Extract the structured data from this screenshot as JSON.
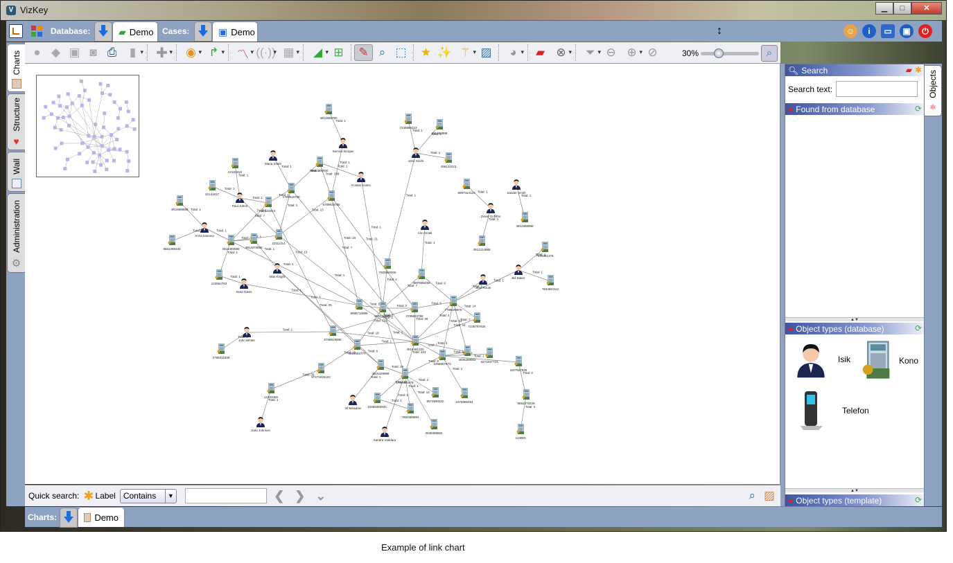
{
  "window": {
    "title": "VizKey",
    "controls": [
      "minimize",
      "maximize",
      "close"
    ]
  },
  "top_tabs": {
    "database_label": "Database:",
    "database_tab": "Demo",
    "cases_label": "Cases:",
    "cases_tab": "Demo"
  },
  "top_right_icons": [
    "user-icon",
    "info-icon",
    "fullscreen-icon",
    "lock-icon",
    "power-icon"
  ],
  "left_tabs": [
    {
      "label": "Charts",
      "icon": "chart-icon",
      "active": true
    },
    {
      "label": "Structure",
      "icon": "hearts-icon"
    },
    {
      "label": "Wall",
      "icon": "wall-icon"
    },
    {
      "label": "Administration",
      "icon": "gear-icon"
    }
  ],
  "toolbar": {
    "icons": [
      "disc-icon",
      "puzzle-icon",
      "window-icon",
      "window-disc-icon",
      "print-icon",
      "clipboard-icon",
      "add-icon",
      "eye-icon",
      "redirect-arrow-icon",
      "line-chart-icon",
      "antenna-icon",
      "map-icon",
      "triangle-icon",
      "fit-icon",
      "link-tool-icon",
      "search-window-icon",
      "select-area-icon",
      "star-icon",
      "stars-icon",
      "magic-wand-icon",
      "picture-icon",
      "palette-icon",
      "eraser-icon",
      "delete-icon",
      "filter-icon",
      "zoom-out-icon",
      "zoom-in-icon",
      "zoom-reset-icon"
    ],
    "zoom_label": "30%",
    "zoom_percent": 30
  },
  "right_panel": {
    "tab_label": "Objects",
    "search_header": "Search",
    "search_text_label": "Search text:",
    "search_value": "",
    "found_header": "Found from database",
    "object_types_db_header": "Object types (database)",
    "object_types": [
      {
        "label": "Isik",
        "icon": "person-icon"
      },
      {
        "label": "Kono",
        "icon": "account-icon"
      },
      {
        "label": "Telefon",
        "icon": "phone-icon"
      }
    ],
    "object_types_template_header": "Object types (template)"
  },
  "quick_search": {
    "label": "Quick search:",
    "field_label": "Label",
    "mode": "Contains",
    "value": ""
  },
  "charts_bar": {
    "label": "Charts:",
    "tab": "Demo"
  },
  "caption": "Example of link chart",
  "colors": {
    "frame": "#8ea3c1",
    "panel_header": "#3d55a0",
    "toolbar": "#eef0f5",
    "edge": "#888888"
  },
  "graph": {
    "nodes": [
      {
        "id": 1,
        "type": "account",
        "label": "4912688780"
      },
      {
        "id": 2,
        "type": "person",
        "label": "Semion Burgas"
      },
      {
        "id": 3,
        "type": "account",
        "label": "7239888123"
      },
      {
        "id": 4,
        "type": "account",
        "label": "231488888"
      },
      {
        "id": 5,
        "type": "person",
        "label": "John Smith"
      },
      {
        "id": 6,
        "type": "account",
        "label": "496122223"
      },
      {
        "id": 7,
        "type": "person",
        "label": "Maria Smith"
      },
      {
        "id": 8,
        "type": "account",
        "label": "9982300000"
      },
      {
        "id": 9,
        "type": "person",
        "label": "Kostas Evans"
      },
      {
        "id": 10,
        "type": "account",
        "label": "22181818"
      },
      {
        "id": 11,
        "type": "account",
        "label": "22141817"
      },
      {
        "id": 12,
        "type": "person",
        "label": "Paul Johns"
      },
      {
        "id": 13,
        "type": "account",
        "label": "22131813"
      },
      {
        "id": 14,
        "type": "account",
        "label": "1799918789"
      },
      {
        "id": 15,
        "type": "account",
        "label": "6789918789"
      },
      {
        "id": 16,
        "type": "account",
        "label": "4916888888"
      },
      {
        "id": 17,
        "type": "person",
        "label": "Anna Ivanova"
      },
      {
        "id": 18,
        "type": "account",
        "label": "8881288333"
      },
      {
        "id": 19,
        "type": "account",
        "label": "4916482999"
      },
      {
        "id": 20,
        "type": "account",
        "label": "4912878888"
      },
      {
        "id": 21,
        "type": "account",
        "label": "22111314"
      },
      {
        "id": 22,
        "type": "person",
        "label": "Max Knight"
      },
      {
        "id": 23,
        "type": "account",
        "label": "123964783"
      },
      {
        "id": 24,
        "type": "person",
        "label": "Sean Davis"
      },
      {
        "id": 25,
        "type": "person",
        "label": "Ann Small"
      },
      {
        "id": 26,
        "type": "account",
        "label": "8987444123"
      },
      {
        "id": 27,
        "type": "person",
        "label": "David Griffiths"
      },
      {
        "id": 28,
        "type": "person",
        "label": "Sander Smith"
      },
      {
        "id": 29,
        "type": "account",
        "label": "4912888999"
      },
      {
        "id": 30,
        "type": "account",
        "label": "4912214888"
      },
      {
        "id": 31,
        "type": "account",
        "label": "7844881378"
      },
      {
        "id": 32,
        "type": "person",
        "label": "Bill Baker"
      },
      {
        "id": 33,
        "type": "account",
        "label": "7844881112"
      },
      {
        "id": 34,
        "type": "person",
        "label": "Jean Roule"
      },
      {
        "id": 35,
        "type": "account",
        "label": "7000000000"
      },
      {
        "id": 36,
        "type": "account",
        "label": "4987896456"
      },
      {
        "id": 37,
        "type": "account",
        "label": "8998710999"
      },
      {
        "id": 38,
        "type": "account",
        "label": "4944422333"
      },
      {
        "id": 39,
        "type": "account",
        "label": "3789618786"
      },
      {
        "id": 40,
        "type": "account",
        "label": "7789189976"
      },
      {
        "id": 41,
        "type": "account",
        "label": "7236787934"
      },
      {
        "id": 42,
        "type": "person",
        "label": "John Whiter"
      },
      {
        "id": 43,
        "type": "account",
        "label": "2789311849"
      },
      {
        "id": 44,
        "type": "account",
        "label": "6789819888"
      },
      {
        "id": 45,
        "type": "account",
        "label": "4916483777"
      },
      {
        "id": 46,
        "type": "account",
        "label": "4916481222"
      },
      {
        "id": 47,
        "type": "account",
        "label": "2268887873"
      },
      {
        "id": 48,
        "type": "account",
        "label": "4938289993"
      },
      {
        "id": 49,
        "type": "account",
        "label": "8271837723"
      },
      {
        "id": 50,
        "type": "account",
        "label": "1187827828"
      },
      {
        "id": 51,
        "type": "account",
        "label": "97473432222"
      },
      {
        "id": 52,
        "type": "account",
        "label": "4916428999"
      },
      {
        "id": 53,
        "type": "account",
        "label": "1744881878"
      },
      {
        "id": 54,
        "type": "account",
        "label": "12123456"
      },
      {
        "id": 55,
        "type": "person",
        "label": "Jane Johnson"
      },
      {
        "id": 56,
        "type": "person",
        "label": "Jill Meadow"
      },
      {
        "id": 57,
        "type": "account",
        "label": "10489393934"
      },
      {
        "id": 58,
        "type": "account",
        "label": "7892389994"
      },
      {
        "id": 59,
        "type": "account",
        "label": "8574890222"
      },
      {
        "id": 60,
        "type": "account",
        "label": "2376889494"
      },
      {
        "id": 61,
        "type": "account",
        "label": "3038398882"
      },
      {
        "id": 62,
        "type": "person",
        "label": "Sandra Vaddara"
      },
      {
        "id": 63,
        "type": "account",
        "label": "8893478328"
      },
      {
        "id": 64,
        "type": "account",
        "label": "123983"
      }
    ],
    "edges": [
      [
        1,
        2,
        "Total: 1"
      ],
      [
        2,
        15,
        "Total: 1"
      ],
      [
        3,
        5,
        "Total: 1"
      ],
      [
        4,
        5,
        "Total: 1"
      ],
      [
        5,
        6,
        "Total: 1"
      ],
      [
        5,
        35,
        "Total: 1"
      ],
      [
        7,
        14,
        "Total: 1"
      ],
      [
        8,
        14,
        "Total: 7"
      ],
      [
        8,
        9,
        "Total: 1"
      ],
      [
        8,
        15,
        "Total: 299"
      ],
      [
        9,
        38,
        "Total: 1"
      ],
      [
        10,
        12,
        "Total: 1"
      ],
      [
        11,
        12,
        "Total: 1"
      ],
      [
        12,
        13,
        "Total: 1"
      ],
      [
        12,
        21,
        "Total: 1"
      ],
      [
        13,
        14,
        "Total: 4"
      ],
      [
        13,
        19,
        "Total: 7"
      ],
      [
        13,
        44,
        "Total: 13"
      ],
      [
        14,
        21,
        "Total: 1"
      ],
      [
        14,
        46,
        "Total: 7"
      ],
      [
        15,
        21,
        "Total: 13"
      ],
      [
        15,
        37,
        "Total: 18"
      ],
      [
        15,
        39,
        "Total: 21"
      ],
      [
        16,
        17,
        "Total: 1"
      ],
      [
        17,
        18,
        "Total: 1"
      ],
      [
        17,
        19,
        "Total: 1"
      ],
      [
        19,
        20,
        "Total: 3"
      ],
      [
        19,
        21,
        "Total: 1"
      ],
      [
        19,
        23,
        "Total: 4"
      ],
      [
        19,
        37,
        "Total: 1"
      ],
      [
        20,
        22,
        "Total: 1"
      ],
      [
        21,
        46,
        "Total: 1"
      ],
      [
        22,
        45,
        "Total: 3"
      ],
      [
        22,
        52,
        "Total: 29"
      ],
      [
        23,
        24,
        "Total: 1"
      ],
      [
        24,
        37,
        "Total: 1"
      ],
      [
        25,
        36,
        "Total: 1"
      ],
      [
        26,
        27,
        "Total: 1"
      ],
      [
        27,
        30,
        "Total: 1"
      ],
      [
        28,
        29,
        "Total: 1"
      ],
      [
        31,
        32,
        "Total: 1"
      ],
      [
        32,
        33,
        "Total: 1"
      ],
      [
        32,
        40,
        "Total: 1"
      ],
      [
        34,
        40,
        "Total: 1"
      ],
      [
        35,
        38,
        "Total: 4"
      ],
      [
        36,
        38,
        "Total: 7"
      ],
      [
        36,
        40,
        "Total: 6"
      ],
      [
        37,
        38,
        "Total: 6"
      ],
      [
        37,
        46,
        "Total: 1"
      ],
      [
        38,
        39,
        "Total: 3"
      ],
      [
        38,
        53,
        "Total: 1"
      ],
      [
        38,
        45,
        "Total: 132"
      ],
      [
        39,
        46,
        "Total: 39"
      ],
      [
        39,
        40,
        "Total: 6"
      ],
      [
        39,
        44,
        "Total: 2"
      ],
      [
        40,
        41,
        "Total: 14"
      ],
      [
        40,
        46,
        "Total: 4"
      ],
      [
        40,
        47,
        "Total: 32"
      ],
      [
        40,
        48,
        "Total: 7"
      ],
      [
        41,
        46,
        "Total: 34"
      ],
      [
        42,
        44,
        "Total: 1"
      ],
      [
        42,
        43,
        "Total: 1"
      ],
      [
        44,
        46,
        "Total: 18"
      ],
      [
        45,
        46,
        "Total: 1"
      ],
      [
        45,
        51,
        "Total: 29"
      ],
      [
        45,
        52,
        "Total: 6"
      ],
      [
        46,
        53,
        "Total: 123"
      ],
      [
        46,
        47,
        "Total: 1"
      ],
      [
        46,
        48,
        "Total: 4"
      ],
      [
        47,
        48,
        "Total: 1"
      ],
      [
        47,
        49,
        "Total: 1"
      ],
      [
        47,
        50,
        "Total: 1"
      ],
      [
        47,
        53,
        "Total: 9"
      ],
      [
        47,
        60,
        "Total: 1"
      ],
      [
        51,
        54,
        "Total: 35"
      ],
      [
        54,
        55,
        "Total: 1"
      ],
      [
        52,
        53,
        "Total: 19"
      ],
      [
        52,
        56,
        "Total: 1"
      ],
      [
        53,
        57,
        "Total: 18"
      ],
      [
        53,
        58,
        "Total: 1"
      ],
      [
        53,
        59,
        "Total: 1"
      ],
      [
        53,
        61,
        "Total: 12"
      ],
      [
        53,
        62,
        "Total: 1"
      ],
      [
        50,
        63,
        "Total: 2"
      ],
      [
        63,
        64,
        "Total: 4"
      ],
      [
        57,
        58,
        "Total: 1"
      ]
    ]
  }
}
